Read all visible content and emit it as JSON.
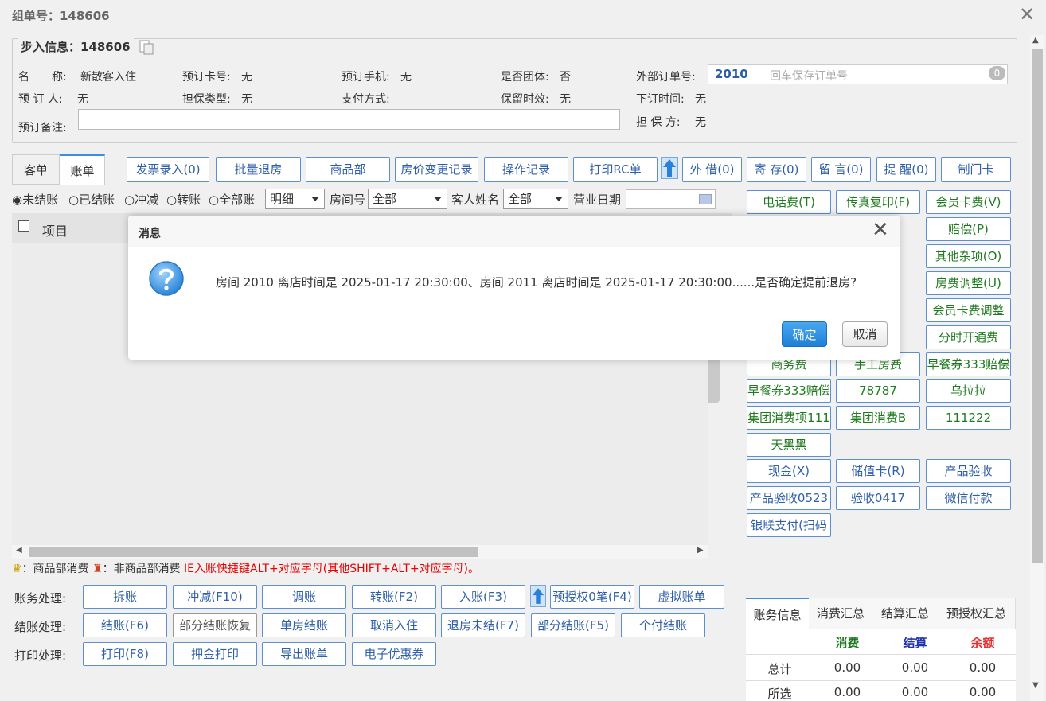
{
  "window": {
    "title": "组单号：148606"
  },
  "info": {
    "legend": "步入信息：148606",
    "fields": {
      "name_label": "名　　称:",
      "name_value": "新散客入住",
      "card_label": "预订卡号:",
      "card_value": "无",
      "phone_label": "预订手机:",
      "phone_value": "无",
      "group_label": "是否团体:",
      "group_value": "否",
      "ext_label": "外部订单号:",
      "booker_label": "预 订 人:",
      "booker_value": "无",
      "guarantee_label": "担保类型:",
      "guarantee_value": "无",
      "pay_label": "支付方式:",
      "hold_label": "保留时效:",
      "hold_value": "无",
      "order_time_label": "下订时间:",
      "order_time_value": "无",
      "memo_label": "预订备注:",
      "guarantor_label": "担 保 方:",
      "guarantor_value": "无"
    },
    "ext_order": {
      "value": "2010",
      "placeholder": "回车保存订单号",
      "badge": "0"
    }
  },
  "tabs": [
    {
      "label": "客单"
    },
    {
      "label": "账单"
    }
  ],
  "toolbar": [
    "发票录入(0)",
    "批量退房",
    "商品部",
    "房价变更记录",
    "操作记录",
    "打印RC单",
    "外 借(0)",
    "寄 存(0)",
    "留 言(0)",
    "提 醒(0)",
    "制门卡"
  ],
  "filters": {
    "radios": [
      "未结账",
      "已结账",
      "冲减",
      "转账",
      "全部账"
    ],
    "detail_select": "明细",
    "room_label": "房间号",
    "room_select": "全部",
    "guest_label": "客人姓名",
    "guest_select": "全部",
    "date_label": "营业日期"
  },
  "grid": {
    "col_item": "项目"
  },
  "right_buttons": {
    "row1": [
      "电话费(T)",
      "传真复印(F)",
      "会员卡费(V)"
    ],
    "row2": [
      "赔偿(P)"
    ],
    "row3": [
      "其他杂项(O)"
    ],
    "row4": [
      "房费调整(U)"
    ],
    "row5": [
      "会员卡费调整"
    ],
    "row6": [
      "分时开通费"
    ],
    "row7": [
      "商务费",
      "手工房费",
      "早餐券333赔偿"
    ],
    "row8": [
      "早餐券333赔偿",
      "78787",
      "乌拉拉"
    ],
    "row9": [
      "集团消费项111",
      "集团消费B",
      "111222"
    ],
    "row10": [
      "天黑黑"
    ],
    "row11": [
      "现金(X)",
      "储值卡(R)",
      "产品验收"
    ],
    "row12": [
      "产品验收0523",
      "验收0417",
      "微信付款"
    ],
    "row13": [
      "银联支付(扫码"
    ]
  },
  "legend_line": {
    "goods": "：商品部消费",
    "non_goods": "：非商品部消费",
    "hint": "IE入账快捷键ALT+对应字母(其他SHIFT+ALT+对应字母)。"
  },
  "bottom": {
    "acct_label": "账务处理:",
    "acct": [
      "拆账",
      "冲减(F10)",
      "调账",
      "转账(F2)",
      "入账(F3)",
      "预授权0笔(F4)",
      "虚拟账单"
    ],
    "settle_label": "结账处理:",
    "settle": [
      "结账(F6)",
      "部分结账恢复",
      "单房结账",
      "取消入住",
      "退房未结(F7)",
      "部分结账(F5)",
      "个付结账"
    ],
    "print_label": "打印处理:",
    "print": [
      "打印(F8)",
      "押金打印",
      "导出账单",
      "电子优惠券"
    ]
  },
  "summary": {
    "tabs": [
      "账务信息",
      "消费汇总",
      "结算汇总",
      "预授权汇总"
    ],
    "headers": [
      "消费",
      "结算",
      "余额"
    ],
    "rows": [
      {
        "label": "总计",
        "values": [
          "0.00",
          "0.00",
          "0.00"
        ]
      },
      {
        "label": "所选",
        "values": [
          "0.00",
          "0.00",
          "0.00"
        ]
      }
    ]
  },
  "dialog": {
    "title": "消息",
    "message": "房间 2010 离店时间是 2025-01-17 20:30:00、房间 2011 离店时间是 2025-01-17 20:30:00......是否确定提前退房?",
    "ok": "确定",
    "cancel": "取消"
  },
  "colors": {
    "accent": "#3a8ee6",
    "button_blue": "#2f5fa8",
    "button_green": "#1f7a1f",
    "hint_red": "#ee0000"
  }
}
